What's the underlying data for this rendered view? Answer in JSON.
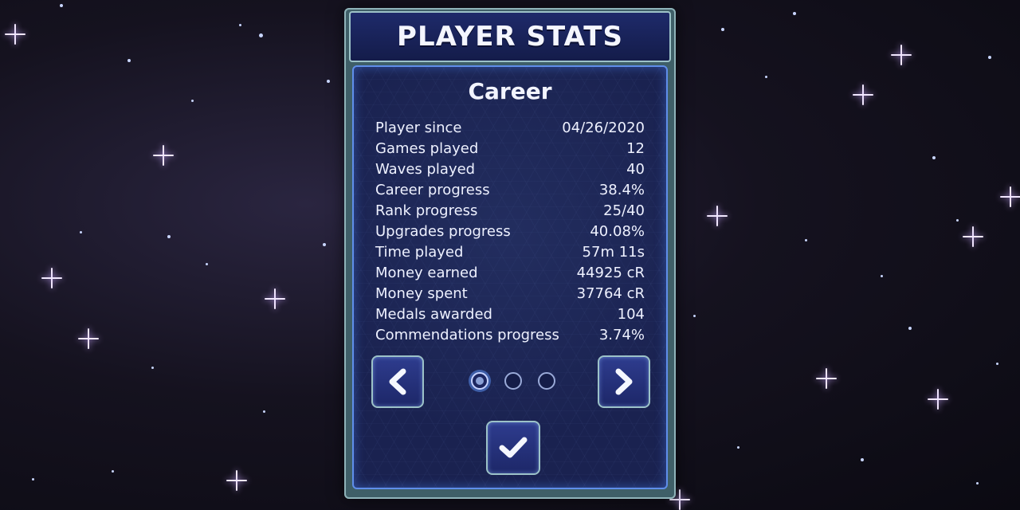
{
  "header": {
    "title": "PLAYER STATS"
  },
  "section": {
    "title": "Career"
  },
  "stats": [
    {
      "label": "Player since",
      "value": "04/26/2020"
    },
    {
      "label": "Games played",
      "value": "12"
    },
    {
      "label": "Waves played",
      "value": "40"
    },
    {
      "label": "Career progress",
      "value": "38.4%"
    },
    {
      "label": "Rank progress",
      "value": "25/40"
    },
    {
      "label": "Upgrades progress",
      "value": "40.08%"
    },
    {
      "label": "Time played",
      "value": "57m 11s"
    },
    {
      "label": "Money earned",
      "value": "44925 cR"
    },
    {
      "label": "Money spent",
      "value": "37764 cR"
    },
    {
      "label": "Medals awarded",
      "value": "104"
    },
    {
      "label": "Commendations progress",
      "value": "3.74%"
    }
  ],
  "pagination": {
    "total_pages": 3,
    "current_page": 1
  },
  "icons": {
    "prev": "chevron-left-icon",
    "next": "chevron-right-icon",
    "confirm": "checkmark-icon"
  },
  "colors": {
    "panel_frame": "#9cc2c8",
    "panel_body": "#1a2250",
    "title_bar": "#1e2a6a",
    "button": "#2e3c8e",
    "text": "#eef1ff"
  }
}
